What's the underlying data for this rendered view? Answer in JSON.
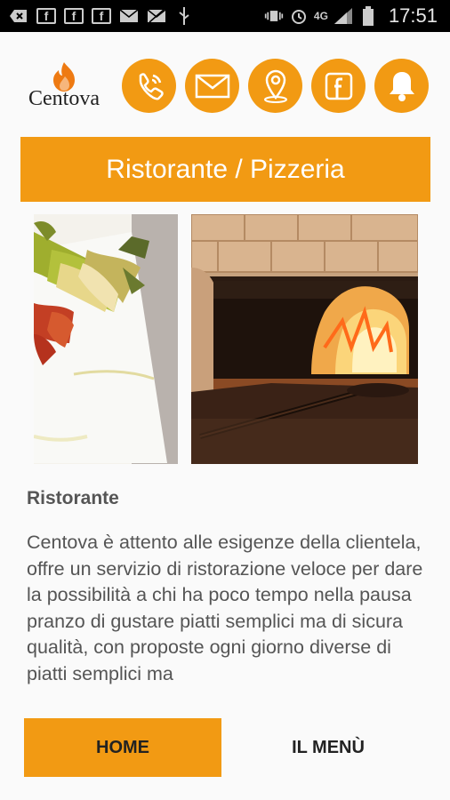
{
  "status_bar": {
    "time": "17:51",
    "network": "4G",
    "icons": [
      "back-arrow-icon",
      "facebook-icon",
      "facebook-icon",
      "facebook-icon",
      "mail-icon",
      "mail-muted-icon",
      "usb-icon",
      "vibrate-icon",
      "alarm-icon",
      "signal-icon",
      "battery-icon"
    ]
  },
  "header": {
    "logo_text": "Centova",
    "actions": [
      "phone-icon",
      "mail-icon",
      "location-icon",
      "facebook-icon",
      "bell-icon"
    ]
  },
  "banner": {
    "title": "Ristorante / Pizzeria"
  },
  "content": {
    "section_title": "Ristorante",
    "description": "Centova è attento alle esigenze della clientela, offre un servizio di ristorazione veloce per dare la possibilità a chi ha poco tempo nella pausa pranzo di gustare piatti semplici ma di sicura qualità, con proposte ogni giorno diverse di piatti semplici ma"
  },
  "nav": {
    "home": "HOME",
    "menu": "IL MENÙ"
  },
  "colors": {
    "accent": "#f29a13",
    "text": "#555555"
  }
}
